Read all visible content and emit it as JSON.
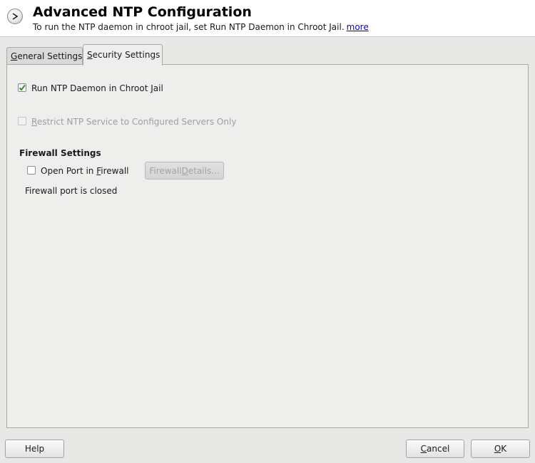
{
  "header": {
    "title": "Advanced NTP Configuration",
    "subtitle": "To run the NTP daemon in chroot jail, set Run NTP Daemon in Chroot Jail.",
    "more_link": "more",
    "icon": "next-arrow-icon"
  },
  "tabs": [
    {
      "label_pre": "",
      "label_ul": "G",
      "label_post": "eneral Settings",
      "active": false
    },
    {
      "label_pre": "",
      "label_ul": "S",
      "label_post": "ecurity Settings",
      "active": true
    }
  ],
  "security": {
    "chroot": {
      "label_pre": "Run NTP Daemon in Chroot ",
      "label_ul": "J",
      "label_post": "ail",
      "checked": true,
      "enabled": true
    },
    "restrict": {
      "label_pre": "",
      "label_ul": "R",
      "label_post": "estrict NTP Service to Configured Servers Only",
      "checked": false,
      "enabled": false
    }
  },
  "firewall": {
    "section_title": "Firewall Settings",
    "open_port": {
      "label_pre": "Open Port in ",
      "label_ul": "F",
      "label_post": "irewall",
      "checked": false
    },
    "details_button": {
      "label_pre": "Firewall ",
      "label_ul": "D",
      "label_post": "etails..."
    },
    "status": "Firewall port is closed"
  },
  "buttons": {
    "help": "Help",
    "cancel": {
      "label_pre": "",
      "label_ul": "C",
      "label_post": "ancel"
    },
    "ok": {
      "label_pre": "",
      "label_ul": "O",
      "label_post": "K"
    }
  },
  "colors": {
    "checkmark": "#3f8a2e",
    "link": "#0000ee"
  }
}
